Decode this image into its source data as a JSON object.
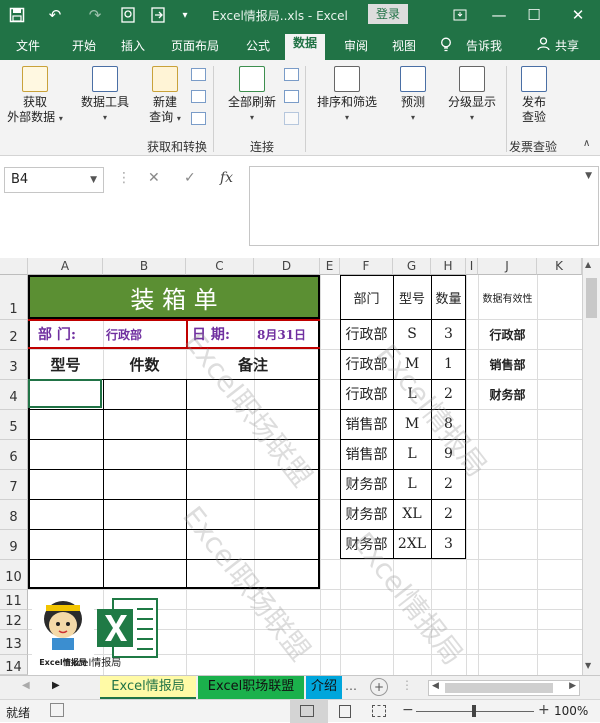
{
  "titlebar": {
    "document_title": "Excel情报局..xls  -  Excel",
    "login_label": "登录"
  },
  "menu": [
    "文件",
    "开始",
    "插入",
    "页面布局",
    "公式",
    "数据",
    "审阅",
    "视图",
    "告诉我",
    "共享"
  ],
  "ribbon": {
    "get_external": [
      "获取",
      "外部数据"
    ],
    "data_tools": "数据工具",
    "new_query": [
      "新建",
      "查询"
    ],
    "group_get_transform": "获取和转换",
    "refresh_all": "全部刷新",
    "group_connections": "连接",
    "sort_filter": "排序和筛选",
    "forecast": "预测",
    "outline": "分级显示",
    "publish": [
      "发布",
      "查验"
    ],
    "group_publish": "发票查验"
  },
  "formula_bar": {
    "name_box": "B4",
    "value": ""
  },
  "columns": [
    "A",
    "B",
    "C",
    "D",
    "E",
    "F",
    "G",
    "H",
    "I",
    "J",
    "K"
  ],
  "rows": [
    "1",
    "2",
    "3",
    "4",
    "5",
    "6",
    "7",
    "8",
    "9",
    "10",
    "11",
    "12",
    "13",
    "14"
  ],
  "sheet": {
    "title": "装 箱 单",
    "dept_label": "部  门:",
    "dept_value": "行政部",
    "date_label": "日  期:",
    "date_value": "8月31日",
    "headers": [
      "型号",
      "件数",
      "备注"
    ]
  },
  "table": {
    "headers": [
      "部门",
      "型号",
      "数量"
    ],
    "rows": [
      [
        "行政部",
        "S",
        "3"
      ],
      [
        "行政部",
        "M",
        "1"
      ],
      [
        "行政部",
        "L",
        "2"
      ],
      [
        "销售部",
        "M",
        "8"
      ],
      [
        "销售部",
        "L",
        "9"
      ],
      [
        "财务部",
        "L",
        "2"
      ],
      [
        "财务部",
        "XL",
        "2"
      ],
      [
        "财务部",
        "2XL",
        "3"
      ]
    ]
  },
  "validation": {
    "title": "数据有效性",
    "items": [
      "行政部",
      "销售部",
      "财务部"
    ]
  },
  "logo_caption": "Excel情报局",
  "watermark": [
    "Excel职场联盟",
    "Excel情报局"
  ],
  "tabs": [
    "Excel情报局",
    "Excel职场联盟",
    "介绍"
  ],
  "status": {
    "ready": "就绪",
    "zoom": "100%"
  },
  "colors": {
    "excel_green": "#217346",
    "title_fill": "#5b8f33",
    "red_line": "#c00000",
    "tab_yellow": "#fffaa6",
    "tab_green": "#1bb14c",
    "tab_blue": "#00a6dc"
  }
}
